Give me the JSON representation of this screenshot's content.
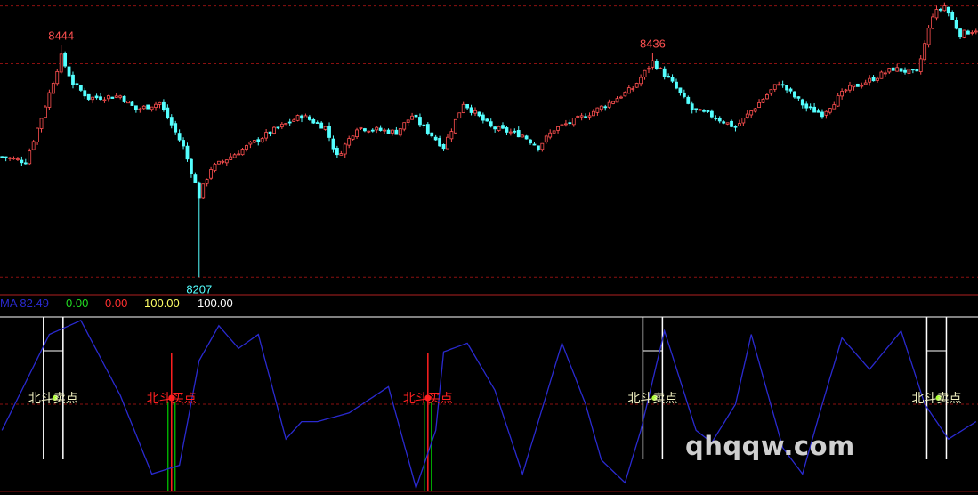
{
  "colors": {
    "background": "#000000",
    "up": "#ff5050",
    "down": "#54ffff",
    "price_line_up": "#ff4444",
    "osc_line": "#2a2ad0",
    "buy": "#ff2020",
    "sell": "#ffffff",
    "green": "#00d000",
    "yellow_green": "#aaff33",
    "grid": "#8b1010"
  },
  "readout": {
    "ma_label": "MA 82.49",
    "v1": "0.00",
    "v2": "0.00",
    "v3": "100.00",
    "v4": "100.00"
  },
  "watermark": "qhqqw.com",
  "chart_data": [
    {
      "type": "candlestick",
      "title": "",
      "ylim": [
        8190,
        8490
      ],
      "grid_levels": [
        8484,
        8425,
        8207
      ],
      "annotations": [
        {
          "label": "8444",
          "index": 15,
          "kind": "high"
        },
        {
          "label": "8436",
          "index": 165,
          "kind": "high"
        },
        {
          "label": "8207",
          "index": 50,
          "kind": "low"
        }
      ],
      "anchors": [
        [
          0,
          8330
        ],
        [
          6,
          8325
        ],
        [
          10,
          8370
        ],
        [
          15,
          8432
        ],
        [
          18,
          8405
        ],
        [
          22,
          8390
        ],
        [
          30,
          8392
        ],
        [
          34,
          8378
        ],
        [
          40,
          8385
        ],
        [
          46,
          8340
        ],
        [
          50,
          8290
        ],
        [
          53,
          8318
        ],
        [
          60,
          8335
        ],
        [
          68,
          8355
        ],
        [
          76,
          8372
        ],
        [
          82,
          8360
        ],
        [
          85,
          8330
        ],
        [
          90,
          8360
        ],
        [
          100,
          8355
        ],
        [
          104,
          8372
        ],
        [
          112,
          8340
        ],
        [
          117,
          8385
        ],
        [
          124,
          8360
        ],
        [
          132,
          8352
        ],
        [
          136,
          8340
        ],
        [
          140,
          8358
        ],
        [
          148,
          8372
        ],
        [
          154,
          8385
        ],
        [
          160,
          8400
        ],
        [
          165,
          8427
        ],
        [
          170,
          8405
        ],
        [
          175,
          8378
        ],
        [
          180,
          8372
        ],
        [
          186,
          8360
        ],
        [
          192,
          8385
        ],
        [
          197,
          8406
        ],
        [
          204,
          8380
        ],
        [
          208,
          8374
        ],
        [
          214,
          8398
        ],
        [
          220,
          8408
        ],
        [
          226,
          8420
        ],
        [
          232,
          8415
        ],
        [
          236,
          8475
        ],
        [
          239,
          8484
        ],
        [
          243,
          8455
        ],
        [
          247,
          8460
        ]
      ],
      "candles": 248
    },
    {
      "type": "line",
      "title": "",
      "series": [
        {
          "name": "MA",
          "last": 82.49
        }
      ],
      "ylim": [
        0,
        100
      ],
      "anchors": [
        [
          0,
          35
        ],
        [
          12,
          90
        ],
        [
          20,
          98
        ],
        [
          30,
          55
        ],
        [
          38,
          10
        ],
        [
          45,
          15
        ],
        [
          50,
          75
        ],
        [
          55,
          95
        ],
        [
          60,
          82
        ],
        [
          65,
          90
        ],
        [
          72,
          30
        ],
        [
          76,
          40
        ],
        [
          80,
          40
        ],
        [
          88,
          45
        ],
        [
          98,
          60
        ],
        [
          105,
          2
        ],
        [
          110,
          35
        ],
        [
          112,
          80
        ],
        [
          118,
          85
        ],
        [
          125,
          58
        ],
        [
          132,
          10
        ],
        [
          138,
          55
        ],
        [
          142,
          85
        ],
        [
          148,
          50
        ],
        [
          152,
          18
        ],
        [
          158,
          5
        ],
        [
          162,
          35
        ],
        [
          168,
          92
        ],
        [
          176,
          35
        ],
        [
          180,
          28
        ],
        [
          186,
          50
        ],
        [
          190,
          90
        ],
        [
          198,
          25
        ],
        [
          203,
          10
        ],
        [
          208,
          50
        ],
        [
          213,
          88
        ],
        [
          220,
          70
        ],
        [
          228,
          92
        ],
        [
          234,
          50
        ],
        [
          240,
          30
        ],
        [
          247,
          40
        ]
      ],
      "signals": [
        {
          "label": "北斗卖点",
          "type": "sell",
          "index": 13
        },
        {
          "label": "北斗买点",
          "type": "buy",
          "index": 43
        },
        {
          "label": "北斗买点",
          "type": "buy",
          "index": 108
        },
        {
          "label": "北斗卖点",
          "type": "sell",
          "index": 165
        },
        {
          "label": "北斗卖点",
          "type": "sell",
          "index": 237
        }
      ],
      "hlines": [
        100,
        50,
        0
      ]
    }
  ]
}
